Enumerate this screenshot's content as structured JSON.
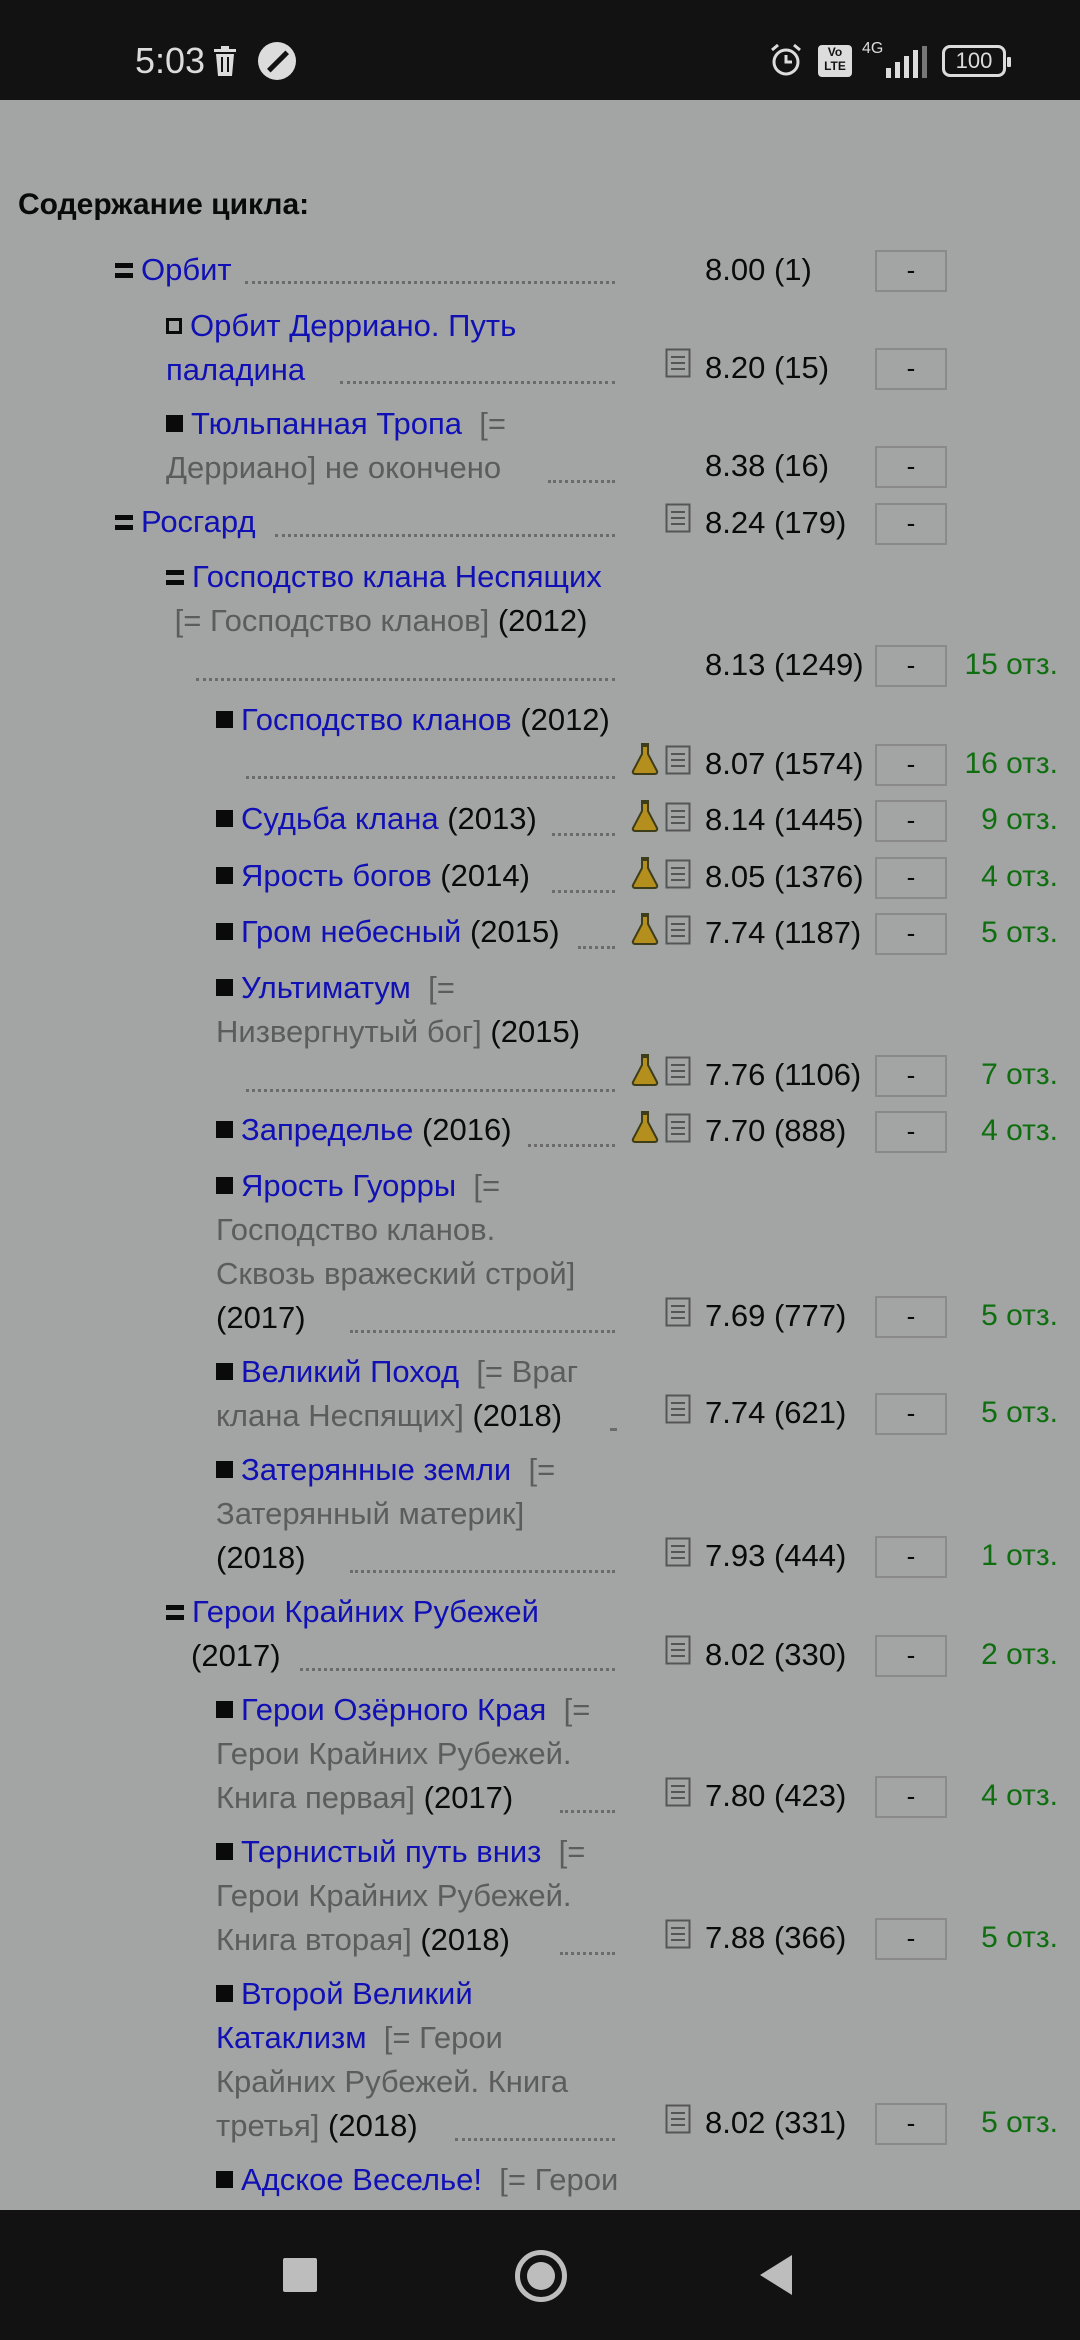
{
  "status": {
    "time": "5:03",
    "network": "4G",
    "battery": "100",
    "volte": "Vo LTE"
  },
  "heading": "Содержание цикла:",
  "action_label": "-",
  "entries": [
    {
      "title": "Орбит",
      "rating": "8.00 (1)"
    },
    {
      "title": "Орбит Дерриано. Путь паладина",
      "title_l1": "Орбит Дерриано. Путь",
      "title_l2": "паладина",
      "rating": "8.20 (15)"
    },
    {
      "title": "Тюльпанная Тропа",
      "alt": "[= Дерриано]",
      "alt_l1": "[=",
      "alt_l2": "Дерриано]",
      "status": "не окончено",
      "rating": "8.38 (16)"
    },
    {
      "title": "Росгард",
      "rating": "8.24 (179)"
    },
    {
      "title": "Господство клана Неспящих",
      "alt": "[= Господство кланов]",
      "year": "(2012)",
      "rating": "8.13 (1249)",
      "reviews": "15 отз."
    },
    {
      "title": "Господство кланов",
      "year": "(2012)",
      "rating": "8.07 (1574)",
      "reviews": "16 отз."
    },
    {
      "title": "Судьба клана",
      "year": "(2013)",
      "rating": "8.14 (1445)",
      "reviews": "9 отз."
    },
    {
      "title": "Ярость богов",
      "year": "(2014)",
      "rating": "8.05 (1376)",
      "reviews": "4 отз."
    },
    {
      "title": "Гром небесный",
      "year": "(2015)",
      "rating": "7.74 (1187)",
      "reviews": "5 отз."
    },
    {
      "title": "Ультиматум",
      "alt_l1": "[=",
      "alt_l2": "Низвергнутый бог]",
      "year": "(2015)",
      "rating": "7.76 (1106)",
      "reviews": "7 отз."
    },
    {
      "title": "Запределье",
      "year": "(2016)",
      "rating": "7.70 (888)",
      "reviews": "4 отз."
    },
    {
      "title": "Ярость Гуорры",
      "alt_l1": "[=",
      "alt_l2": "Господство кланов.",
      "alt_l3": "Сквозь вражеский строй]",
      "year": "(2017)",
      "rating": "7.69 (777)",
      "reviews": "5 отз."
    },
    {
      "title": "Великий Поход",
      "alt_l1": "[= Враг",
      "alt_l2": "клана Неспящих]",
      "year": "(2018)",
      "rating": "7.74 (621)",
      "reviews": "5 отз."
    },
    {
      "title": "Затерянные земли",
      "alt_l1": "[=",
      "alt_l2": "Затерянный материк]",
      "year": "(2018)",
      "rating": "7.93 (444)",
      "reviews": "1 отз."
    },
    {
      "title": "Герои Крайних Рубежей",
      "year": "(2017)",
      "rating": "8.02 (330)",
      "reviews": "2 отз."
    },
    {
      "title": "Герои Озёрного Края",
      "alt_l1": "[=",
      "alt_l2": "Герои Крайних Рубежей.",
      "alt_l3": "Книга первая]",
      "year": "(2017)",
      "rating": "7.80 (423)",
      "reviews": "4 отз."
    },
    {
      "title": "Тернистый путь вниз",
      "alt_l1": "[=",
      "alt_l2": "Герои Крайних Рубежей.",
      "alt_l3": "Книга вторая]",
      "year": "(2018)",
      "rating": "7.88 (366)",
      "reviews": "5 отз."
    },
    {
      "title_l1": "Второй Великий",
      "title_l2": "Катаклизм",
      "alt_l1": "[= Герои",
      "alt_l2": "Крайних Рубежей. Книга",
      "alt_l3": "третья]",
      "year": "(2018)",
      "rating": "8.02 (331)",
      "reviews": "5 отз."
    },
    {
      "title": "Адское Веселье!",
      "alt_l1": "[= Герои"
    }
  ]
}
